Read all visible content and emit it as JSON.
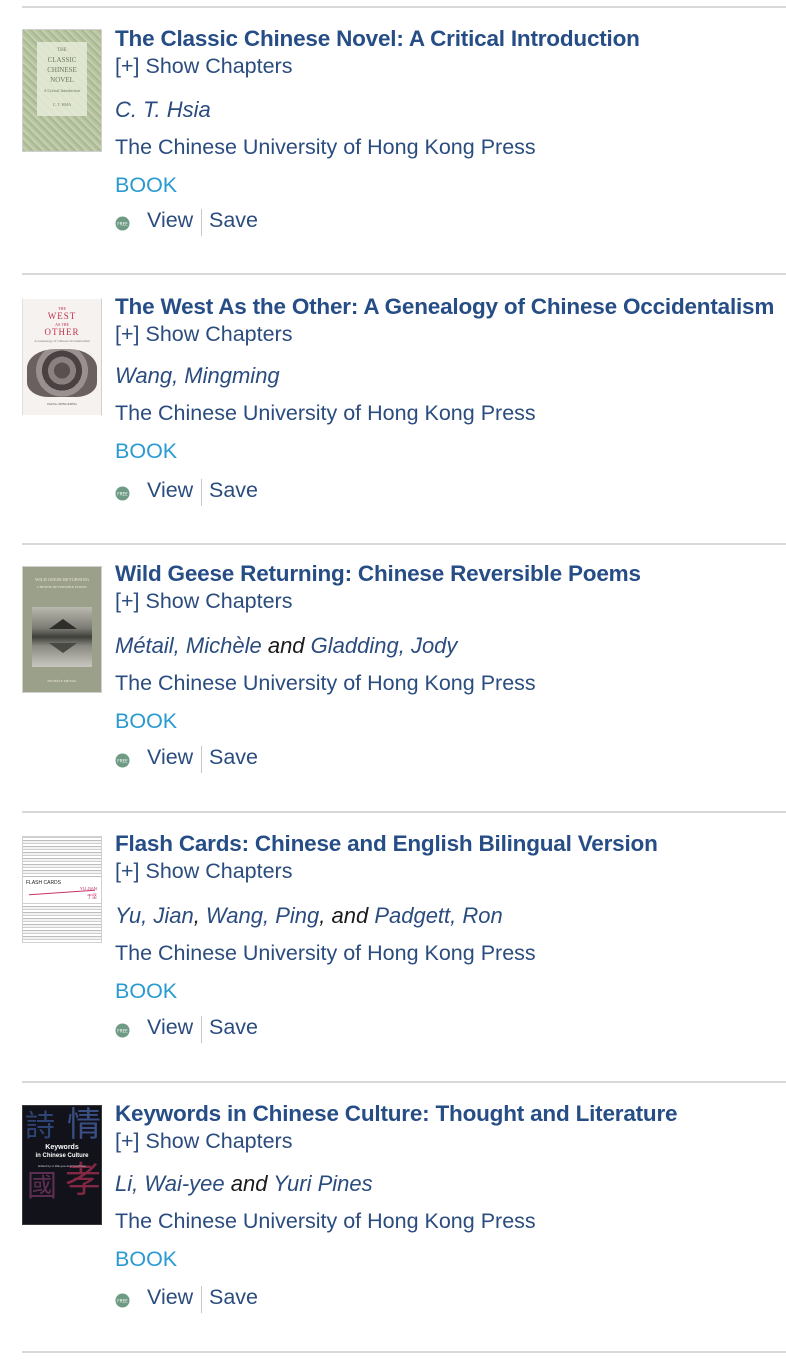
{
  "labels": {
    "show_chapters": "[+] Show Chapters",
    "view": "View",
    "save": "Save",
    "free_badge": "FREE"
  },
  "results": [
    {
      "title": "The Classic Chinese Novel: A Critical Introduction",
      "authors": [
        "C. T. Hsia"
      ],
      "connectors": [],
      "publisher": "The Chinese University of Hong Kong Press",
      "type": "BOOK",
      "cover": {
        "lines": [
          "THE",
          "CLASSIC",
          "CHINESE",
          "NOVEL",
          "A Critical Introduction",
          "C. T. HSIA"
        ]
      }
    },
    {
      "title": "The West As the Other: A Genealogy of Chinese Occidentalism",
      "authors": [
        "Wang, Mingming"
      ],
      "connectors": [],
      "publisher": "The Chinese University of Hong Kong Press",
      "type": "BOOK",
      "cover": {
        "lines": [
          "THE",
          "WEST",
          "AS THE",
          "OTHER",
          "A Genealogy of Chinese Occidentalism",
          "WANG MINGMING"
        ]
      }
    },
    {
      "title": "Wild Geese Returning: Chinese Reversible Poems",
      "authors": [
        "Métail, Michèle",
        "Gladding, Jody"
      ],
      "connectors": [
        " and "
      ],
      "publisher": "The Chinese University of Hong Kong Press",
      "type": "BOOK",
      "cover": {
        "lines": [
          "WILD GEESE RETURNING",
          "CHINESE REVERSIBLE POEMS",
          "MICHÈLE MÉTAIL"
        ]
      }
    },
    {
      "title": "Flash Cards: Chinese and English Bilingual Version",
      "authors": [
        "Yu, Jian",
        "Wang, Ping",
        "Padgett, Ron"
      ],
      "connectors": [
        ", ",
        ", and "
      ],
      "publisher": "The Chinese University of Hong Kong Press",
      "type": "BOOK",
      "cover": {
        "lines": [
          "FLASH CARDS",
          "YU JIAN",
          "于坚"
        ]
      }
    },
    {
      "title": "Keywords in Chinese Culture: Thought and Literature",
      "authors": [
        "Li, Wai-yee",
        "Yuri Pines"
      ],
      "connectors": [
        " and "
      ],
      "publisher": "The Chinese University of Hong Kong Press",
      "type": "BOOK",
      "cover": {
        "lines": [
          "Keywords",
          "in Chinese Culture",
          "Edited by Li Wai-yee and Yuri Pines"
        ]
      }
    }
  ],
  "colors": {
    "title": "#264d86",
    "link": "#2b4c7e",
    "type": "#2a9bd1",
    "rule": "#d9d9d9",
    "free_badge": "#6f9a84"
  }
}
